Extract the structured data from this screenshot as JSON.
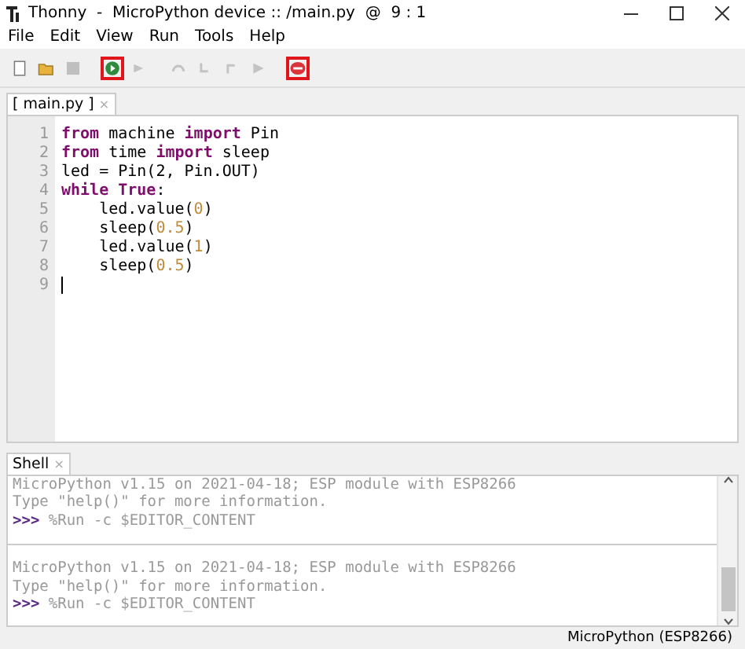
{
  "window": {
    "title": "Thonny  -  MicroPython device :: /main.py  @  9 : 1"
  },
  "menu": [
    "File",
    "Edit",
    "View",
    "Run",
    "Tools",
    "Help"
  ],
  "toolbar": [
    {
      "kind": "new",
      "highlighted": false,
      "disabled": false
    },
    {
      "kind": "open",
      "highlighted": false,
      "disabled": false
    },
    {
      "kind": "save",
      "highlighted": false,
      "disabled": true
    },
    {
      "kind": "run",
      "highlighted": true,
      "disabled": false
    },
    {
      "kind": "debug",
      "highlighted": false,
      "disabled": true
    },
    {
      "kind": "step-over",
      "highlighted": false,
      "disabled": true
    },
    {
      "kind": "step-into",
      "highlighted": false,
      "disabled": true
    },
    {
      "kind": "step-out",
      "highlighted": false,
      "disabled": true
    },
    {
      "kind": "resume",
      "highlighted": false,
      "disabled": true
    },
    {
      "kind": "stop",
      "highlighted": true,
      "disabled": false
    }
  ],
  "editor_tab": {
    "label": "[ main.py ]",
    "close": "×"
  },
  "code": [
    {
      "number": "1",
      "tokens": [
        {
          "kind": "keyword",
          "text": "from"
        },
        {
          "kind": "plain",
          "text": " machine "
        },
        {
          "kind": "keyword",
          "text": "import"
        },
        {
          "kind": "plain",
          "text": " Pin"
        }
      ]
    },
    {
      "number": "2",
      "tokens": [
        {
          "kind": "keyword",
          "text": "from"
        },
        {
          "kind": "plain",
          "text": " time "
        },
        {
          "kind": "keyword",
          "text": "import"
        },
        {
          "kind": "plain",
          "text": " sleep"
        }
      ]
    },
    {
      "number": "3",
      "tokens": [
        {
          "kind": "plain",
          "text": "led = Pin(2, Pin.OUT)"
        }
      ]
    },
    {
      "number": "4",
      "tokens": [
        {
          "kind": "keyword",
          "text": "while True"
        },
        {
          "kind": "plain",
          "text": ":"
        }
      ]
    },
    {
      "number": "5",
      "tokens": [
        {
          "kind": "plain",
          "text": "    led.value("
        },
        {
          "kind": "number",
          "text": "0"
        },
        {
          "kind": "plain",
          "text": ")"
        }
      ]
    },
    {
      "number": "6",
      "tokens": [
        {
          "kind": "plain",
          "text": "    sleep("
        },
        {
          "kind": "number",
          "text": "0.5"
        },
        {
          "kind": "plain",
          "text": ")"
        }
      ]
    },
    {
      "number": "7",
      "tokens": [
        {
          "kind": "plain",
          "text": "    led.value("
        },
        {
          "kind": "number",
          "text": "1"
        },
        {
          "kind": "plain",
          "text": ")"
        }
      ]
    },
    {
      "number": "8",
      "tokens": [
        {
          "kind": "plain",
          "text": "    sleep("
        },
        {
          "kind": "number",
          "text": "0.5"
        },
        {
          "kind": "plain",
          "text": ")"
        }
      ]
    },
    {
      "number": "9",
      "cursor": true
    }
  ],
  "shell_tab": {
    "label": "Shell",
    "close": "×"
  },
  "shell": [
    {
      "kind": "output",
      "text": "MicroPython v1.15 on 2021-04-18; ESP module with ESP8266"
    },
    {
      "kind": "output",
      "text": "Type \"help()\" for more information."
    },
    {
      "kind": "prompt",
      "prompt": ">>>",
      "text": " %Run -c $EDITOR_CONTENT"
    },
    {
      "kind": "separator"
    },
    {
      "kind": "output",
      "text": "MicroPython v1.15 on 2021-04-18; ESP module with ESP8266"
    },
    {
      "kind": "output",
      "text": "Type \"help()\" for more information."
    },
    {
      "kind": "prompt",
      "prompt": ">>>",
      "text": " %Run -c $EDITOR_CONTENT"
    }
  ],
  "status_bar": {
    "interpreter": "MicroPython (ESP8266)"
  }
}
